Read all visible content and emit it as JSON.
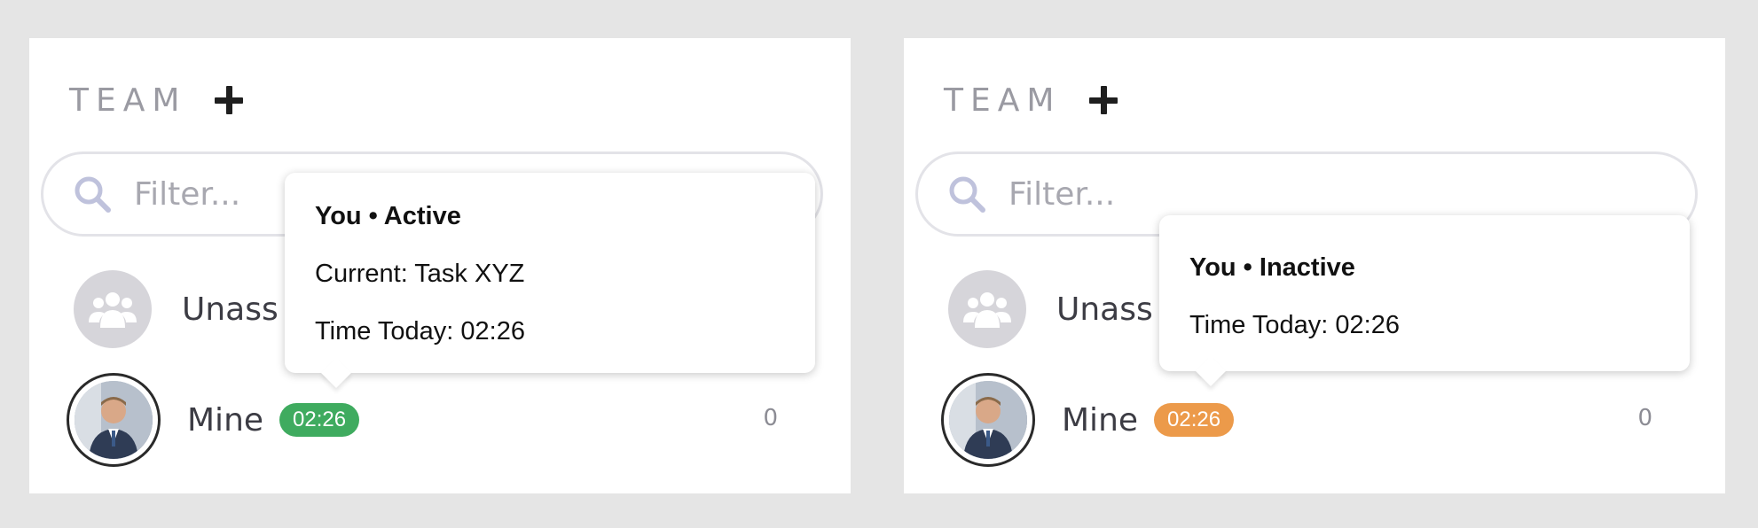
{
  "left": {
    "team_title": "TEAM",
    "search_placeholder": "Filter...",
    "unassigned_label": "Unass",
    "mine_label": "Mine",
    "time_badge": "02:26",
    "badge_color": "#3fab5f",
    "count": "0",
    "tooltip": {
      "title": "You • Active",
      "current": "Current: Task XYZ",
      "time_today": "Time Today: 02:26"
    }
  },
  "right": {
    "team_title": "TEAM",
    "search_placeholder": "Filter...",
    "unassigned_label": "Unass",
    "mine_label": "Mine",
    "time_badge": "02:26",
    "badge_color": "#ec9a4a",
    "count": "0",
    "tooltip": {
      "title": "You • Inactive",
      "time_today": "Time Today: 02:26"
    }
  },
  "icons": [
    "plus-icon",
    "search-icon",
    "group-icon",
    "user-avatar"
  ]
}
